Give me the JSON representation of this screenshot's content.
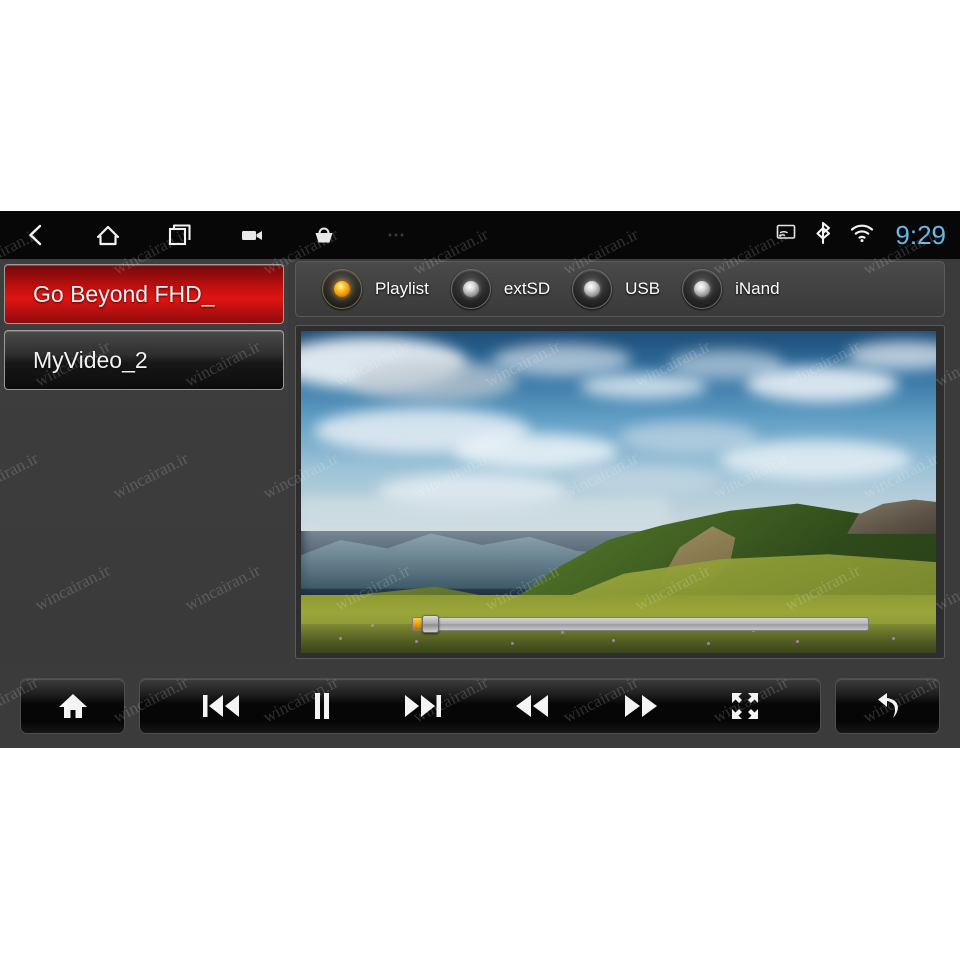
{
  "statusbar": {
    "nav": [
      {
        "name": "back-icon",
        "label": "Back"
      },
      {
        "name": "home-icon",
        "label": "Home"
      },
      {
        "name": "recents-icon",
        "label": "Recent apps"
      },
      {
        "name": "video-camera-icon",
        "label": "Camera"
      },
      {
        "name": "basket-icon",
        "label": "Apps"
      },
      {
        "name": "overflow-menu-icon",
        "label": "More"
      }
    ],
    "sys_icons": [
      {
        "name": "cast-icon",
        "label": "Cast"
      },
      {
        "name": "bluetooth-icon",
        "label": "Bluetooth"
      },
      {
        "name": "wifi-icon",
        "label": "Wi-Fi"
      }
    ],
    "clock": "9:29",
    "clock_color": "#63b8e8"
  },
  "playlist": {
    "items": [
      {
        "label": "Go Beyond FHD_",
        "selected": true
      },
      {
        "label": "MyVideo_2",
        "selected": false
      }
    ],
    "selected_color": "#e01414"
  },
  "sources": {
    "options": [
      {
        "label": "Playlist",
        "selected": true
      },
      {
        "label": "extSD",
        "selected": false
      },
      {
        "label": "USB",
        "selected": false
      },
      {
        "label": "iNand",
        "selected": false
      }
    ],
    "active_led_color": "#ffc425",
    "idle_led_color": "#d8d8d8"
  },
  "player": {
    "seek_percent": 2.5,
    "seek_fill_color": "#e79b10",
    "seek_track_color": "#b8b8b8",
    "video_description": "Mountain landscape with blue sky, clouds, green ridge and flowering alpine meadow"
  },
  "controls": {
    "home_group": [
      {
        "name": "home-button",
        "label": "Home"
      }
    ],
    "transport_group": [
      {
        "name": "previous-track-button",
        "label": "Previous"
      },
      {
        "name": "pause-button",
        "label": "Pause"
      },
      {
        "name": "next-track-button",
        "label": "Next"
      },
      {
        "name": "rewind-button",
        "label": "Rewind"
      },
      {
        "name": "fast-forward-button",
        "label": "Fast forward"
      },
      {
        "name": "fullscreen-button",
        "label": "Fullscreen"
      }
    ],
    "back_group": [
      {
        "name": "return-button",
        "label": "Return"
      }
    ]
  },
  "watermark": {
    "text": "wincairan.ir"
  },
  "theme": {
    "app_background": "#3b3b3b",
    "statusbar_background": "#070707",
    "page_background": "#ffffff"
  }
}
